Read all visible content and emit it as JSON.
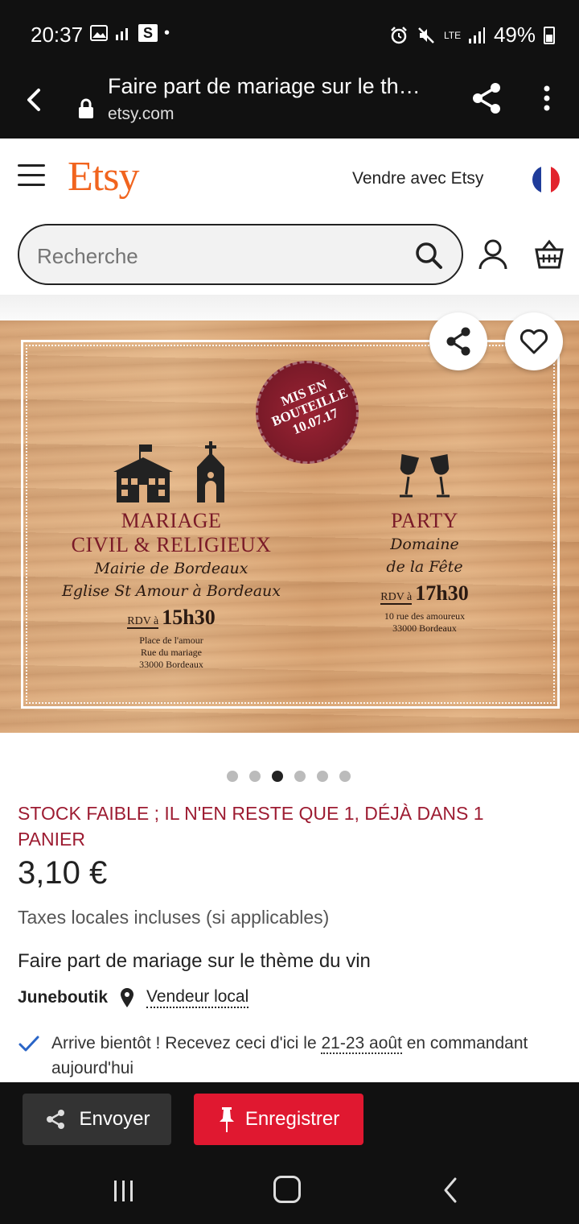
{
  "status_bar": {
    "time": "20:37",
    "network": "LTE",
    "battery": "49%",
    "s_icon": "S",
    "dot": "•"
  },
  "browser": {
    "page_title": "Faire part de mariage sur le th…",
    "domain": "etsy.com"
  },
  "header": {
    "logo": "Etsy",
    "sell_link": "Vendre avec Etsy",
    "search_placeholder": "Recherche"
  },
  "hero": {
    "stamp": "MIS EN BOUTEILLE 10.07.17",
    "left": {
      "title_line1": "MARIAGE",
      "title_line2": "CIVIL & RELIGIEUX",
      "script1": "Mairie de Bordeaux",
      "script2": "Eglise St Amour à Bordeaux",
      "rdv_label": "RDV à",
      "rdv_time": "15h30",
      "address1": "Place de l'amour",
      "address2": "Rue du mariage",
      "address3": "33000 Bordeaux"
    },
    "right": {
      "title": "PARTY",
      "script1": "Domaine",
      "script2": "de la Fête",
      "rdv_label": "RDV à",
      "rdv_time": "17h30",
      "address1": "10 rue des amoureux",
      "address2": "33000 Bordeaux"
    },
    "carousel_count": 6,
    "carousel_active": 3
  },
  "product": {
    "stock_notice": "STOCK FAIBLE ; IL N'EN RESTE QUE 1, DÉJÀ DANS 1 PANIER",
    "price": "3,10 €",
    "taxes": "Taxes locales incluses (si applicables)",
    "title": "Faire part de mariage sur le thème du vin",
    "shop": "Juneboutik",
    "local_seller": "Vendeur local",
    "delivery_before": "Arrive bientôt ! Recevez ceci d'ici le ",
    "delivery_date": "21-23 août",
    "delivery_after": " en commandant aujourd'hui"
  },
  "actions": {
    "send": "Envoyer",
    "save": "Enregistrer"
  },
  "colors": {
    "etsy_orange": "#f1641e",
    "stock_red": "#9d1c32",
    "save_red": "#e01830",
    "wine": "#7a1a28"
  }
}
